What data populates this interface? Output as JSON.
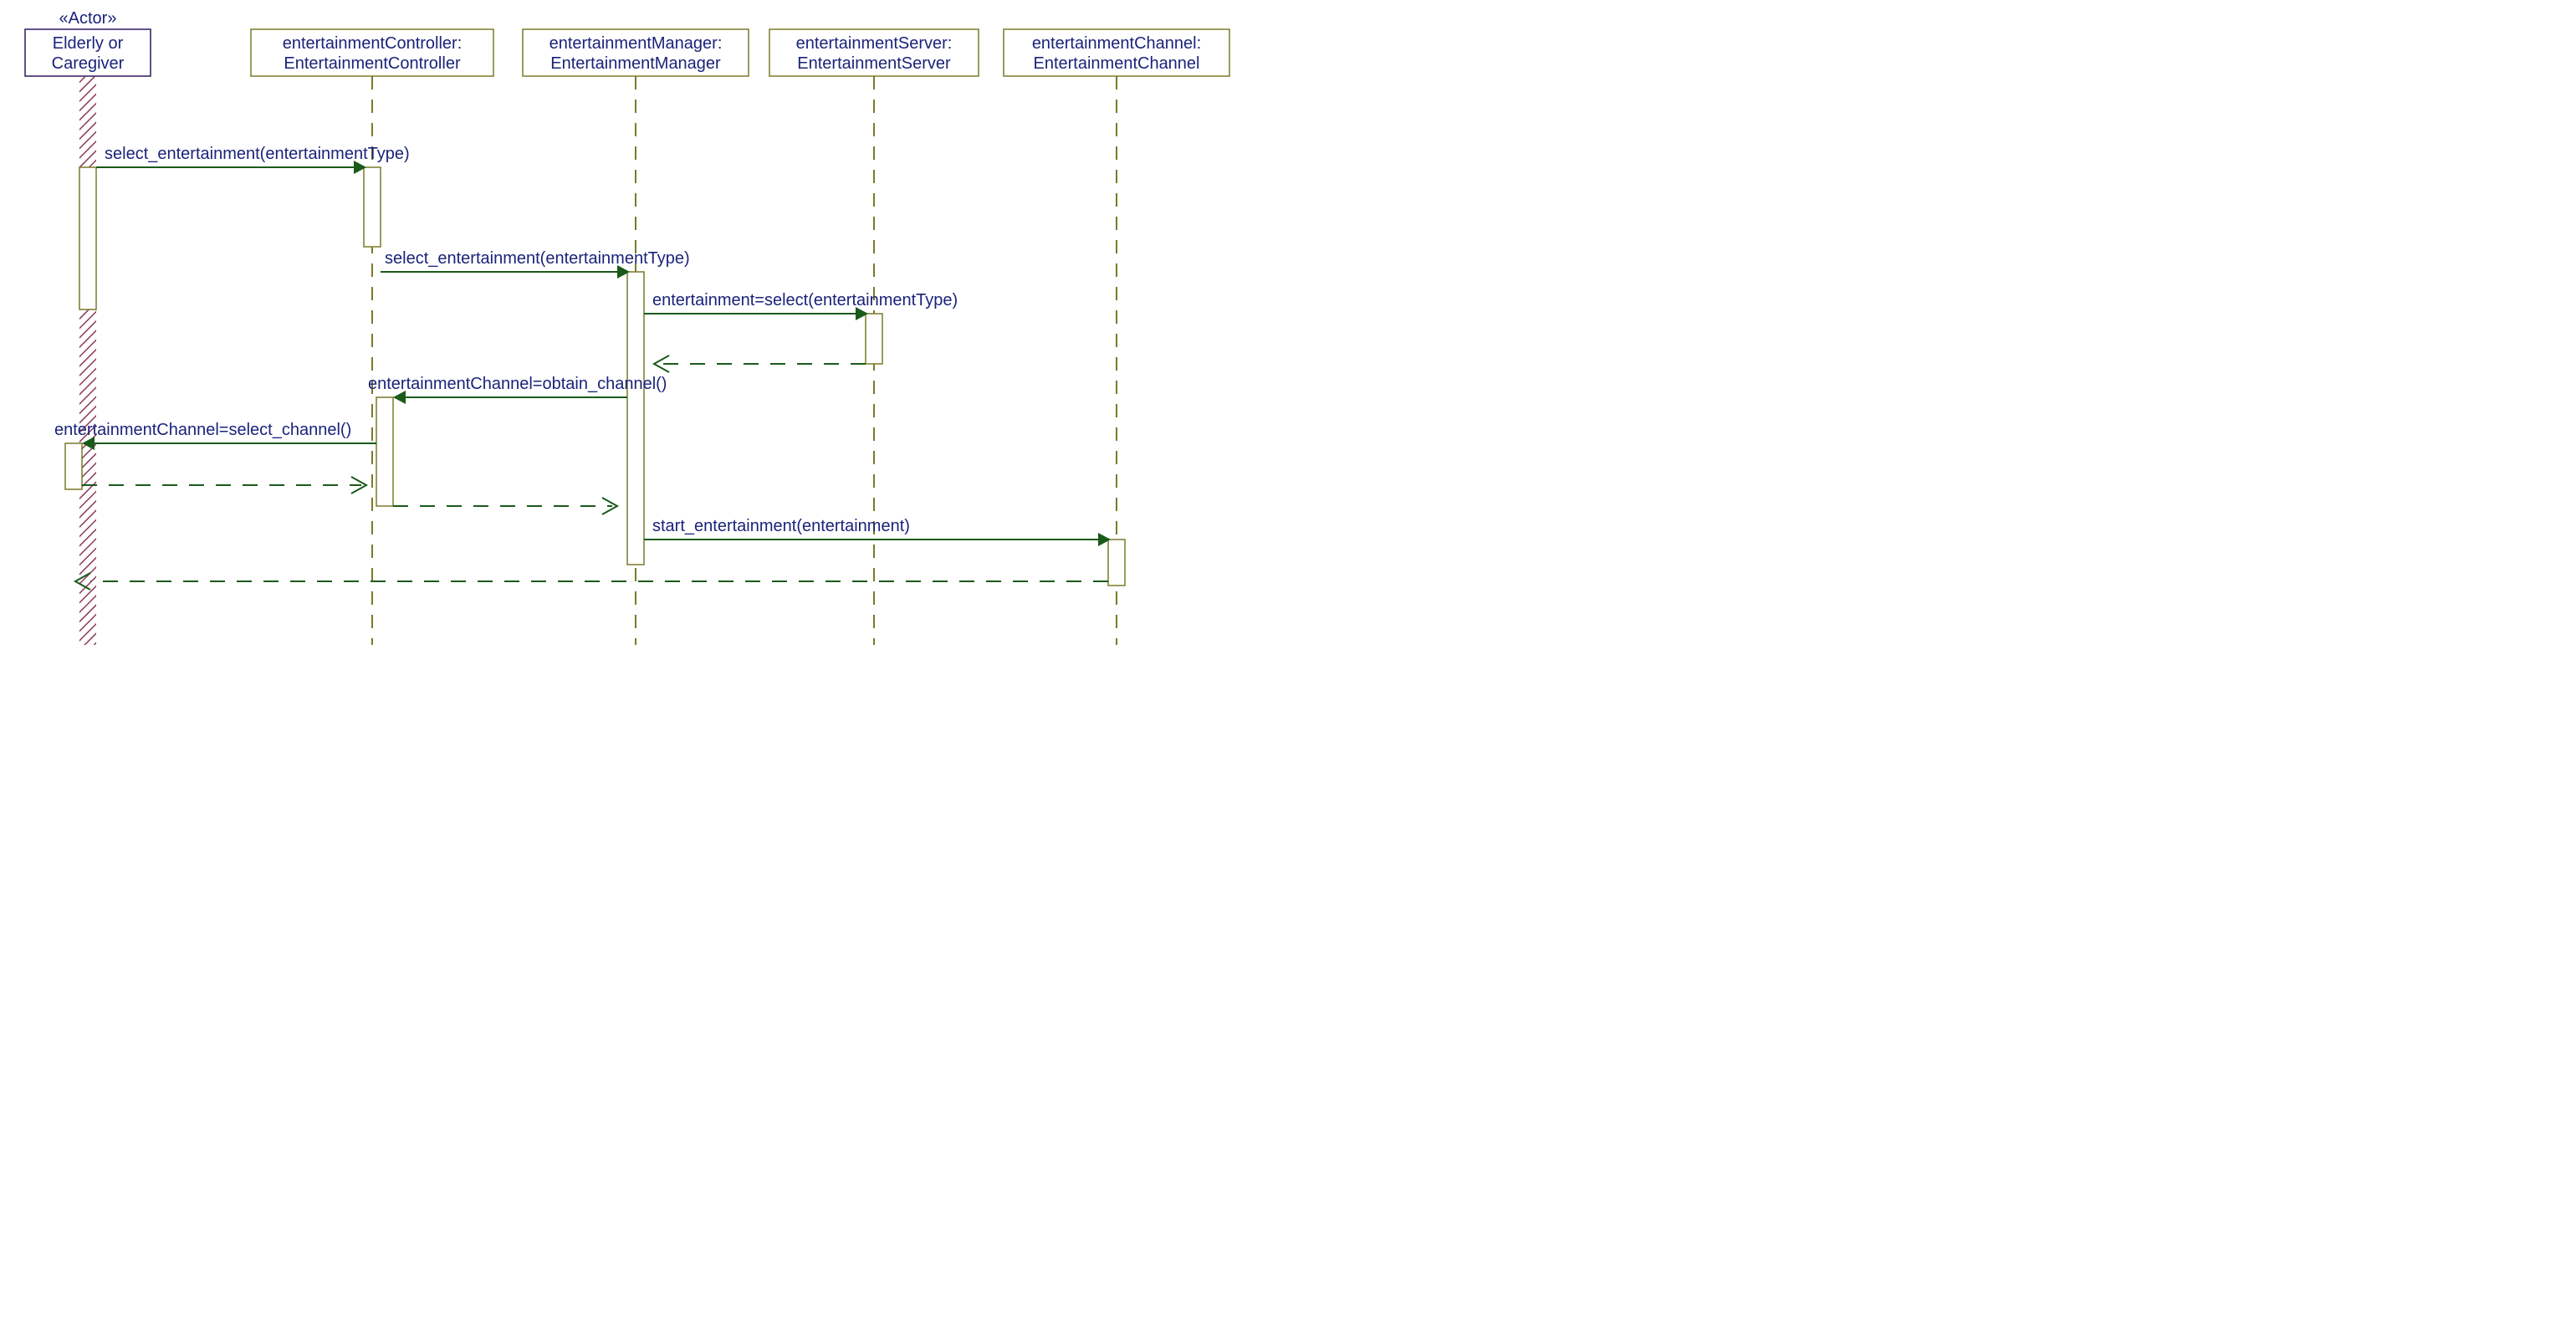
{
  "actor": {
    "stereotype": "«Actor»",
    "line1": "Elderly or",
    "line2": "Caregiver"
  },
  "participants": {
    "controller": {
      "line1": "entertainmentController:",
      "line2": "EntertainmentController"
    },
    "manager": {
      "line1": "entertainmentManager:",
      "line2": "EntertainmentManager"
    },
    "server": {
      "line1": "entertainmentServer:",
      "line2": "EntertainmentServer"
    },
    "channel": {
      "line1": "entertainmentChannel:",
      "line2": "EntertainmentChannel"
    }
  },
  "messages": {
    "m1": "select_entertainment(entertainmentType)",
    "m2": "select_entertainment(entertainmentType)",
    "m3": "entertainment=select(entertainmentType)",
    "m4": "entertainmentChannel=obtain_channel()",
    "m5": "entertainmentChannel=select_channel()",
    "m6": "start_entertainment(entertainment)"
  }
}
